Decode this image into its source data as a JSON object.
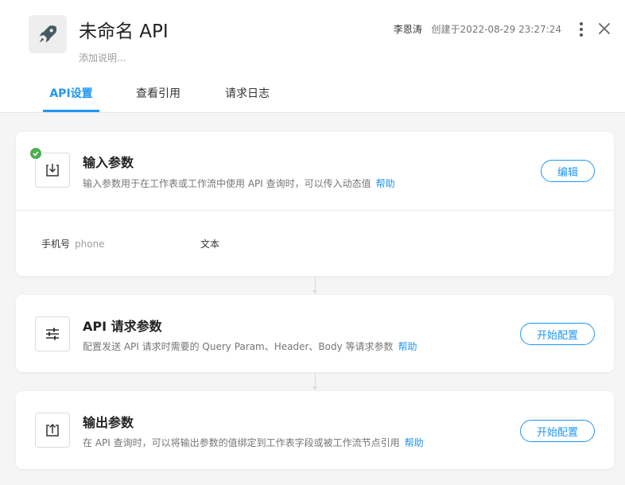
{
  "header": {
    "title": "未命名 API",
    "description": "添加说明...",
    "author": "李恩涛",
    "created": "创建于2022-08-29 23:27:24",
    "app_icon": "rocket-icon",
    "accent_color": "#2196f3"
  },
  "tabs": [
    {
      "label": "API设置",
      "active": true
    },
    {
      "label": "查看引用",
      "active": false
    },
    {
      "label": "请求日志",
      "active": false
    }
  ],
  "cards": {
    "input": {
      "title": "输入参数",
      "description": "输入参数用于在工作表或工作流中使用 API 查询时，可以传入动态值",
      "help": "帮助",
      "button": "编辑",
      "icon": "import-icon",
      "completed": true,
      "params": [
        {
          "name": "手机号",
          "key": "phone",
          "type": "文本"
        }
      ]
    },
    "request": {
      "title": "API 请求参数",
      "description": "配置发送 API 请求时需要的 Query Param、Header、Body 等请求参数",
      "help": "帮助",
      "button": "开始配置",
      "icon": "sliders-icon"
    },
    "output": {
      "title": "输出参数",
      "description": "在 API 查询时，可以将输出参数的值绑定到工作表字段或被工作流节点引用",
      "help": "帮助",
      "button": "开始配置",
      "icon": "export-icon"
    }
  },
  "colors": {
    "accent": "#2196f3",
    "success": "#4caf50"
  }
}
